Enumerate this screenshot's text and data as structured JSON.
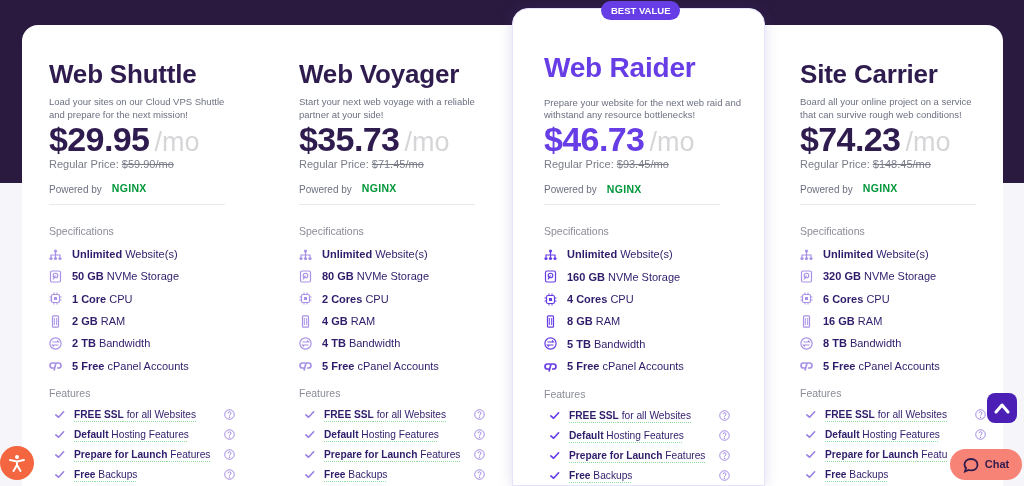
{
  "plans": [
    {
      "name": "Web Shuttle",
      "featured": false,
      "description": "Load your sites on our Cloud VPS Shuttle and prepare for the next mission!",
      "price": "$29.95",
      "period": "/mo",
      "regular_label": "Regular Price:",
      "regular_price": "$59.90/mo",
      "powered_by": "Powered by",
      "server": "NGINX",
      "specs_label": "Specifications",
      "specs": [
        {
          "kind": "websites",
          "text": "**Unlimited** Website(s)"
        },
        {
          "kind": "storage",
          "text": "**50 GB** NVMe Storage"
        },
        {
          "kind": "cpu",
          "text": "**1 Core** CPU"
        },
        {
          "kind": "ram",
          "text": "**2 GB** RAM"
        },
        {
          "kind": "bandwidth",
          "text": "**2 TB** Bandwidth"
        },
        {
          "kind": "cpanel",
          "text": "**5 Free** cPanel Accounts"
        }
      ],
      "features_label": "Features",
      "features": [
        {
          "text": "**FREE SSL** for all Websites",
          "tooltip": true
        },
        {
          "text": "**Default** Hosting Features",
          "tooltip": true
        },
        {
          "text": "**Prepare for Launch** Features",
          "tooltip": true
        },
        {
          "text": "**Free** Backups",
          "tooltip": true
        }
      ]
    },
    {
      "name": "Web Voyager",
      "featured": false,
      "description": "Start your next web voyage with a reliable partner at your side!",
      "price": "$35.73",
      "period": "/mo",
      "regular_label": "Regular Price:",
      "regular_price": "$71.45/mo",
      "powered_by": "Powered by",
      "server": "NGINX",
      "specs_label": "Specifications",
      "specs": [
        {
          "kind": "websites",
          "text": "**Unlimited** Website(s)"
        },
        {
          "kind": "storage",
          "text": "**80 GB** NVMe Storage"
        },
        {
          "kind": "cpu",
          "text": "**2 Cores** CPU"
        },
        {
          "kind": "ram",
          "text": "**4 GB** RAM"
        },
        {
          "kind": "bandwidth",
          "text": "**4 TB** Bandwidth"
        },
        {
          "kind": "cpanel",
          "text": "**5 Free** cPanel Accounts"
        }
      ],
      "features_label": "Features",
      "features": [
        {
          "text": "**FREE SSL** for all Websites",
          "tooltip": true
        },
        {
          "text": "**Default** Hosting Features",
          "tooltip": true
        },
        {
          "text": "**Prepare for Launch** Features",
          "tooltip": true
        },
        {
          "text": "**Free** Backups",
          "tooltip": true
        }
      ]
    },
    {
      "name": "Web Raider",
      "featured": true,
      "badge": "BEST VALUE",
      "description": "Prepare your website for the next web raid and withstand any resource bottlenecks!",
      "price": "$46.73",
      "period": "/mo",
      "regular_label": "Regular Price:",
      "regular_price": "$93.45/mo",
      "powered_by": "Powered by",
      "server": "NGINX",
      "specs_label": "Specifications",
      "specs": [
        {
          "kind": "websites",
          "text": "**Unlimited** Website(s)"
        },
        {
          "kind": "storage",
          "text": "**160 GB** NVMe Storage"
        },
        {
          "kind": "cpu",
          "text": "**4 Cores** CPU"
        },
        {
          "kind": "ram",
          "text": "**8 GB** RAM"
        },
        {
          "kind": "bandwidth",
          "text": "**5 TB** Bandwidth"
        },
        {
          "kind": "cpanel",
          "text": "**5 Free** cPanel Accounts"
        }
      ],
      "features_label": "Features",
      "features": [
        {
          "text": "**FREE SSL** for all Websites",
          "tooltip": true
        },
        {
          "text": "**Default** Hosting Features",
          "tooltip": true
        },
        {
          "text": "**Prepare for Launch** Features",
          "tooltip": true
        },
        {
          "text": "**Free** Backups",
          "tooltip": true
        }
      ]
    },
    {
      "name": "Site Carrier",
      "featured": false,
      "description": "Board all your online project on a service that can survive rough web conditions!",
      "price": "$74.23",
      "period": "/mo",
      "regular_label": "Regular Price:",
      "regular_price": "$148.45/mo",
      "powered_by": "Powered by",
      "server": "NGINX",
      "specs_label": "Specifications",
      "specs": [
        {
          "kind": "websites",
          "text": "**Unlimited** Website(s)"
        },
        {
          "kind": "storage",
          "text": "**320 GB** NVMe Storage"
        },
        {
          "kind": "cpu",
          "text": "**6 Cores** CPU"
        },
        {
          "kind": "ram",
          "text": "**16 GB** RAM"
        },
        {
          "kind": "bandwidth",
          "text": "**8 TB** Bandwidth"
        },
        {
          "kind": "cpanel",
          "text": "**5 Free** cPanel Accounts"
        }
      ],
      "features_label": "Features",
      "features": [
        {
          "text": "**FREE SSL** for all Websites",
          "tooltip": true
        },
        {
          "text": "**Default** Hosting Features",
          "tooltip": true
        },
        {
          "text": "**Prepare for Launch** Featu",
          "tooltip": false
        },
        {
          "text": "**Free** Backups",
          "tooltip": false
        }
      ]
    }
  ],
  "chat_button": "Chat"
}
